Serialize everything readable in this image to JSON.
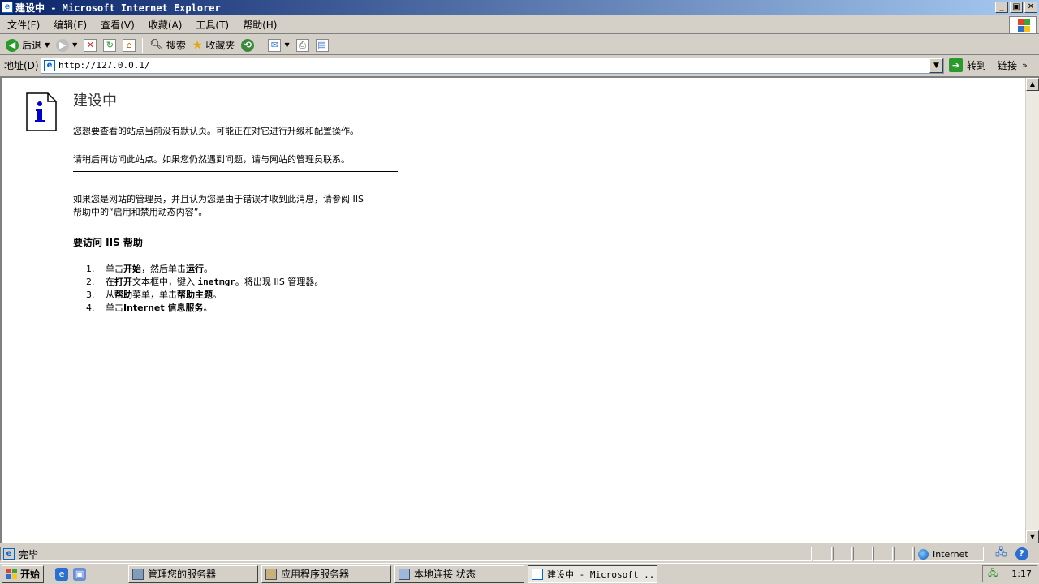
{
  "window": {
    "title": "建设中 - Microsoft Internet Explorer",
    "app_icon": "ie-icon",
    "buttons": [
      "_",
      "▣",
      "✕"
    ]
  },
  "menubar": {
    "items": [
      {
        "label": "文件(F)"
      },
      {
        "label": "编辑(E)"
      },
      {
        "label": "查看(V)"
      },
      {
        "label": "收藏(A)"
      },
      {
        "label": "工具(T)"
      },
      {
        "label": "帮助(H)"
      }
    ]
  },
  "toolbar": {
    "back_label": "后退",
    "search_label": "搜索",
    "favorites_label": "收藏夹"
  },
  "address": {
    "label": "地址(D)",
    "url": "http://127.0.0.1/",
    "go_label": "转到",
    "links_label": "链接"
  },
  "page": {
    "heading": "建设中",
    "p1": "您想要查看的站点当前没有默认页。可能正在对它进行升级和配置操作。",
    "p2": "请稍后再访问此站点。如果您仍然遇到问题，请与网站的管理员联系。",
    "p3_line1": "如果您是网站的管理员，并且认为您是由于错误才收到此消息，请参阅 IIS",
    "p3_line2": "帮助中的“启用和禁用动态内容”。",
    "iis_help_heading": "要访问 IIS 帮助",
    "steps": [
      {
        "num": "1.",
        "a": "单击",
        "b": "开始",
        "c": "，然后单击",
        "d": "运行",
        "e": "。"
      },
      {
        "num": "2.",
        "a": "在",
        "b": "打开",
        "c": "文本框中，键入 ",
        "d": "inetmgr",
        "e": "。将出现 IIS 管理器。"
      },
      {
        "num": "3.",
        "a": "从",
        "b": "帮助",
        "c": "菜单，单击",
        "d": "帮助主题",
        "e": "。"
      },
      {
        "num": "4.",
        "a": "单击",
        "b": "Internet 信息服务",
        "c": "",
        "d": "",
        "e": "。"
      }
    ]
  },
  "statusbar": {
    "status_text": "完毕",
    "zone_label": "Internet"
  },
  "taskbar": {
    "start_label": "开始",
    "tasks": [
      {
        "label": "管理您的服务器"
      },
      {
        "label": "应用程序服务器"
      },
      {
        "label": "本地连接 状态"
      },
      {
        "label": "建设中 - Microsoft ..."
      }
    ],
    "clock": "1:17"
  },
  "colors": {
    "titlebar_start": "#0a246a",
    "titlebar_end": "#a6caf0",
    "chrome": "#d4d0c8"
  }
}
